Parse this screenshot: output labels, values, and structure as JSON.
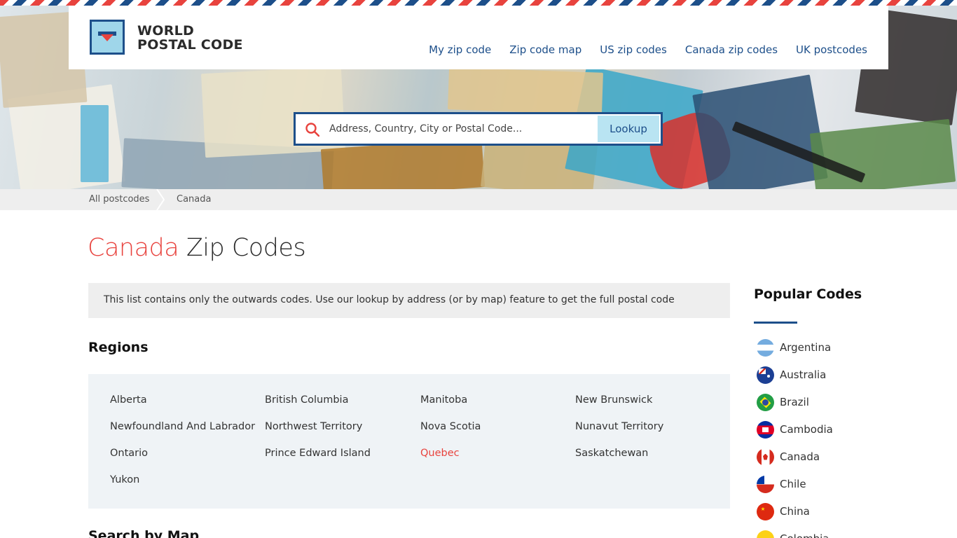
{
  "brand": {
    "line1": "WORLD",
    "line2": "POSTAL CODE"
  },
  "nav": [
    {
      "label": "My zip code"
    },
    {
      "label": "Zip code map"
    },
    {
      "label": "US zip codes"
    },
    {
      "label": "Canada zip codes"
    },
    {
      "label": "UK postcodes"
    }
  ],
  "search": {
    "placeholder": "Address, Country, City or Postal Code...",
    "button": "Lookup"
  },
  "breadcrumb": [
    {
      "label": "All postcodes"
    },
    {
      "label": "Canada"
    }
  ],
  "title": {
    "highlight": "Canada",
    "rest": " Zip Codes"
  },
  "notice": "This list contains only the outwards codes. Use our lookup by address (or by map) feature to get the full postal code",
  "regions": {
    "heading": "Regions",
    "items": [
      {
        "label": "Alberta"
      },
      {
        "label": "British Columbia"
      },
      {
        "label": "Manitoba"
      },
      {
        "label": "New Brunswick"
      },
      {
        "label": "Newfoundland And Labrador"
      },
      {
        "label": "Northwest Territory"
      },
      {
        "label": "Nova Scotia"
      },
      {
        "label": "Nunavut Territory"
      },
      {
        "label": "Ontario"
      },
      {
        "label": "Prince Edward Island"
      },
      {
        "label": "Quebec",
        "active": true
      },
      {
        "label": "Saskatchewan"
      },
      {
        "label": "Yukon"
      }
    ]
  },
  "map_section": {
    "heading": "Search by Map"
  },
  "popular": {
    "heading": "Popular Codes",
    "items": [
      {
        "label": "Argentina",
        "flag": "argentina-flag-icon"
      },
      {
        "label": "Australia",
        "flag": "australia-flag-icon"
      },
      {
        "label": "Brazil",
        "flag": "brazil-flag-icon"
      },
      {
        "label": "Cambodia",
        "flag": "cambodia-flag-icon"
      },
      {
        "label": "Canada",
        "flag": "canada-flag-icon"
      },
      {
        "label": "Chile",
        "flag": "chile-flag-icon"
      },
      {
        "label": "China",
        "flag": "china-flag-icon"
      },
      {
        "label": "Colombia",
        "flag": "colombia-flag-icon"
      }
    ]
  },
  "colors": {
    "accent_red": "#e8433e",
    "brand_blue": "#1d4f8a",
    "light_blue": "#b9e4f2"
  }
}
